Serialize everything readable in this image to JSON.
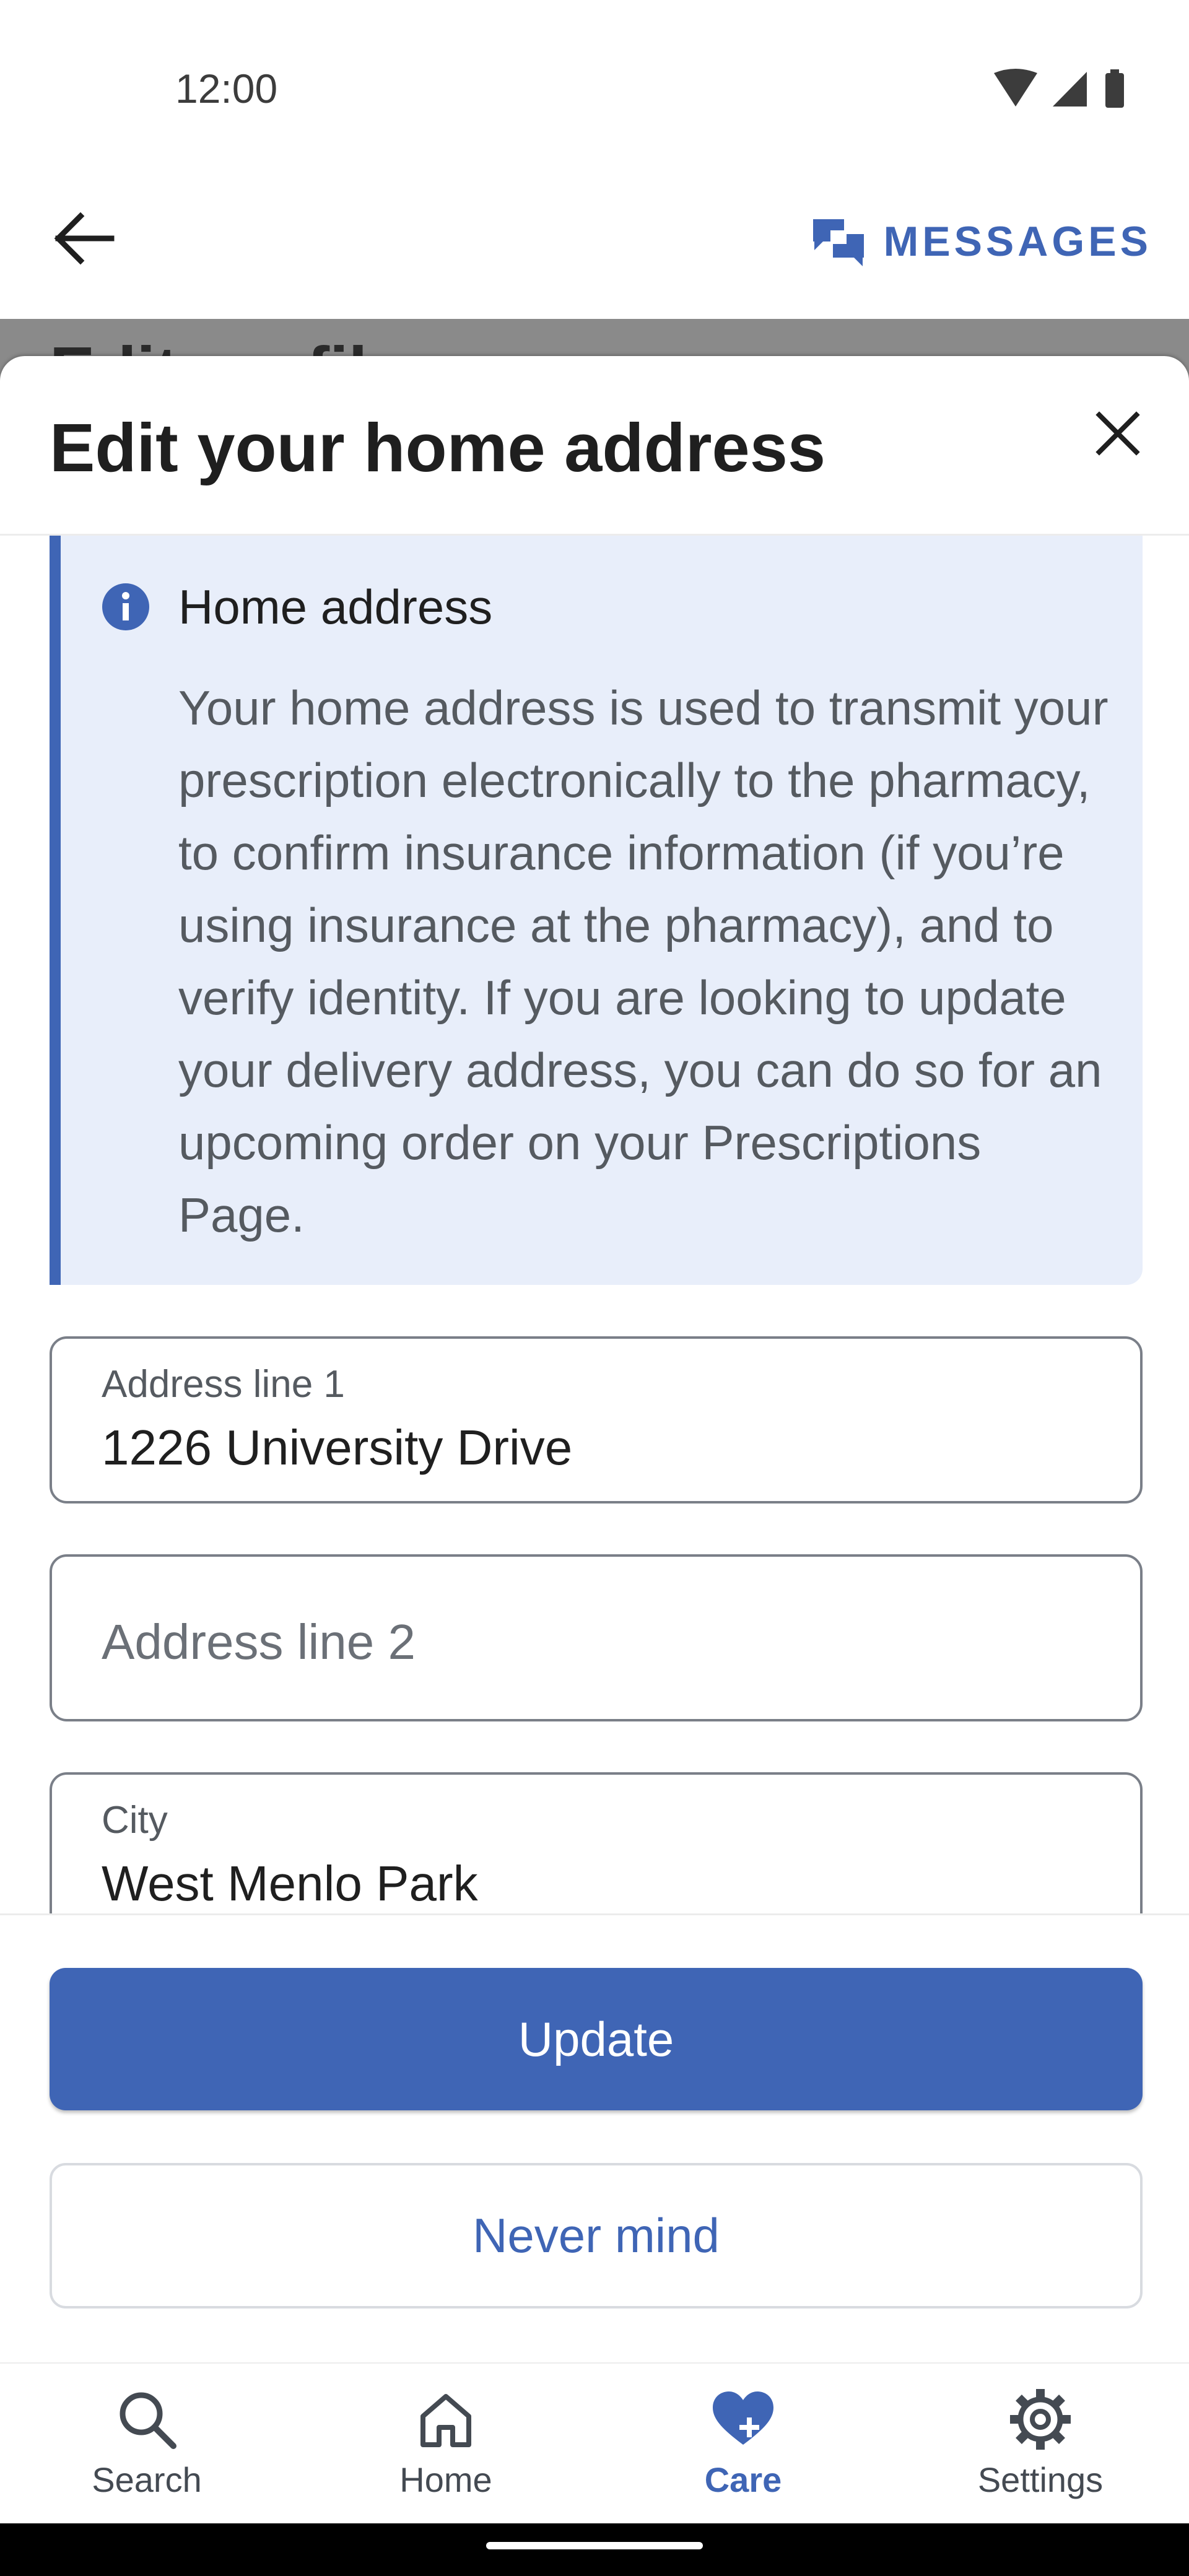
{
  "status_bar": {
    "time": "12:00",
    "icons": [
      "wifi-icon",
      "signal-icon",
      "battery-icon"
    ]
  },
  "app_bar": {
    "back_icon": "arrow-left-icon",
    "messages_label": "MESSAGES",
    "messages_icon": "chat-bubbles-icon"
  },
  "background_page": {
    "title": "Edit profile"
  },
  "sheet": {
    "title": "Edit your home address",
    "close_icon": "close-icon",
    "info": {
      "icon": "info-icon",
      "heading": "Home address",
      "body": "Your home address is used to transmit your prescription electronically to the pharmacy, to confirm insurance information (if you’re using insurance at the pharmacy), and to verify identity. If you are looking to update your delivery address, you can do so for an upcoming order on your Prescriptions Page."
    },
    "fields": {
      "address1": {
        "label": "Address line 1",
        "value": "1226 University Drive"
      },
      "address2": {
        "label": "",
        "placeholder": "Address line 2",
        "value": ""
      },
      "city": {
        "label": "City",
        "value": "West Menlo Park"
      }
    },
    "buttons": {
      "update": "Update",
      "never_mind": "Never mind"
    }
  },
  "bottom_nav": {
    "items": [
      {
        "label": "Search",
        "icon": "search-icon",
        "active": false
      },
      {
        "label": "Home",
        "icon": "home-icon",
        "active": false
      },
      {
        "label": "Care",
        "icon": "heart-plus-icon",
        "active": true
      },
      {
        "label": "Settings",
        "icon": "gear-icon",
        "active": false
      }
    ]
  },
  "colors": {
    "primary": "#3f65b5",
    "info_background": "#e8eefa",
    "scrim": "#8a8a8a"
  }
}
